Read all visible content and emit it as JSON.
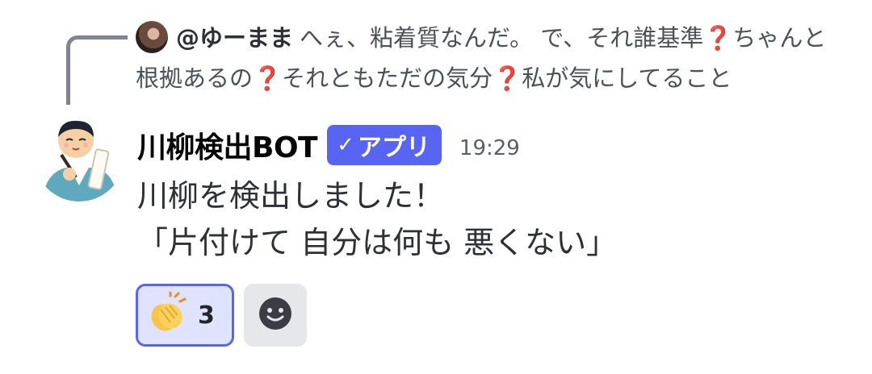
{
  "reply": {
    "author": "@ゆーまま",
    "segments": [
      {
        "text": "へぇ、粘着質なんだ。 で、それ誰基準",
        "kind": "text"
      },
      {
        "text": "❓",
        "kind": "emoji"
      },
      {
        "text": "ちゃんと根拠あるの",
        "kind": "text"
      },
      {
        "text": "❓",
        "kind": "emoji"
      },
      {
        "text": "それともただの気分",
        "kind": "text"
      },
      {
        "text": "❓",
        "kind": "emoji"
      },
      {
        "text": "私が気にしてること",
        "kind": "text"
      }
    ]
  },
  "message": {
    "author": "川柳検出BOT",
    "badge": "アプリ",
    "badge_icon": "check-icon",
    "timestamp": "19:29",
    "lines": [
      "川柳を検出しました！",
      "「片付けて 自分は何も 悪くない」"
    ]
  },
  "reactions": [
    {
      "emoji": "clapping-hands-icon",
      "count": "3",
      "active": true
    },
    {
      "emoji": "add-reaction-icon",
      "active": false
    }
  ],
  "colors": {
    "accent": "#5865f2",
    "reaction_bg": "#e0e3ff",
    "connector": "#80848e",
    "question_mark": "#dd2e44"
  }
}
